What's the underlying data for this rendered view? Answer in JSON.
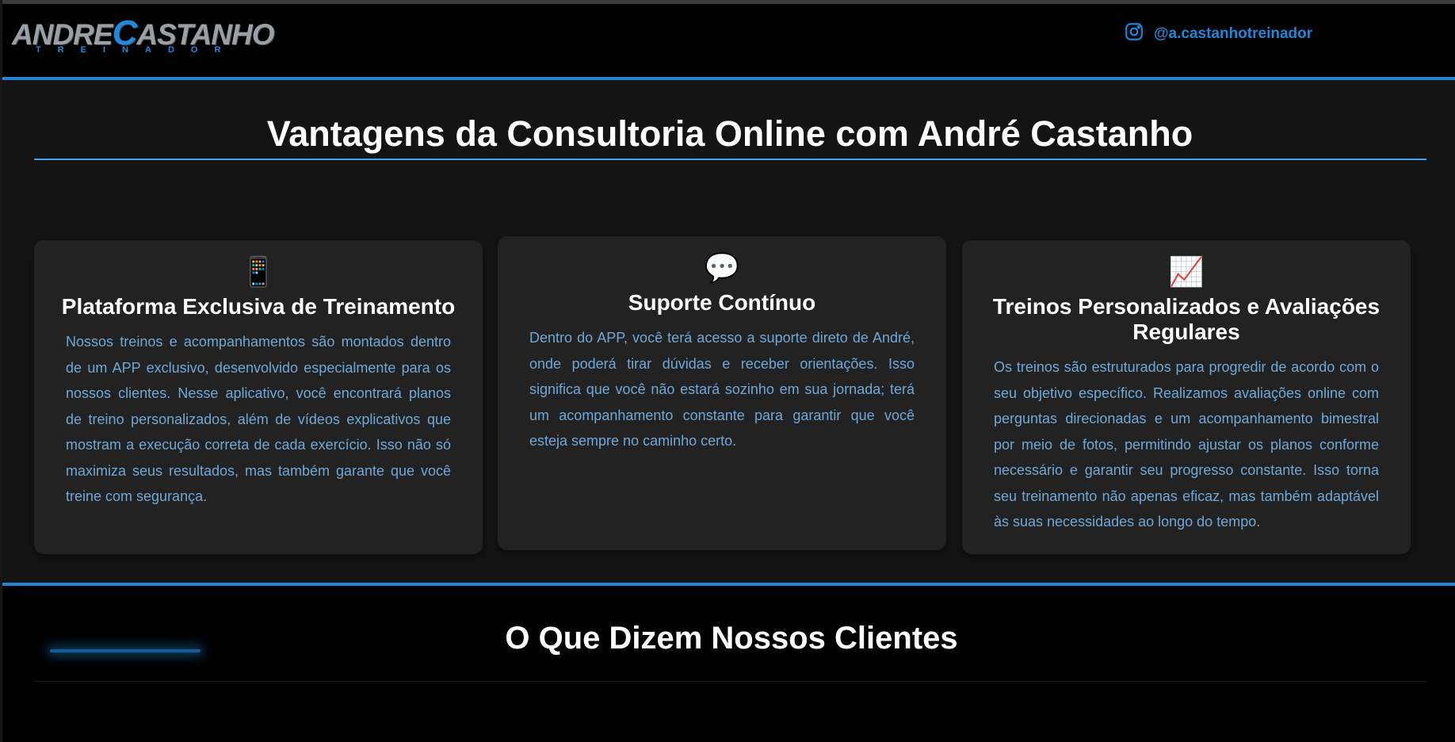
{
  "header": {
    "logo_main_1": "ANDRE",
    "logo_main_accent": "C",
    "logo_main_2": "ASTANHO",
    "logo_sub": "TREINADOR",
    "instagram_handle": "@a.castanhotreinador",
    "instagram_icon": "instagram-icon",
    "accent_color": "#1e88d8"
  },
  "advantages": {
    "title": "Vantagens da Consultoria Online com André Castanho",
    "cards": [
      {
        "icon": "📱",
        "icon_name": "mobile-phone-icon",
        "title": "Plataforma Exclusiva de Treinamento",
        "text": "Nossos treinos e acompanhamentos são montados dentro de um APP exclusivo, desenvolvido especialmente para os nossos clientes. Nesse aplicativo, você encontrará planos de treino personalizados, além de vídeos explicativos que mostram a execução correta de cada exercício. Isso não só maximiza seus resultados, mas também garante que você treine com segurança."
      },
      {
        "icon": "💬",
        "icon_name": "speech-bubble-icon",
        "title": "Suporte Contínuo",
        "text": "Dentro do APP, você terá acesso a suporte direto de André, onde poderá tirar dúvidas e receber orientações. Isso significa que você não estará sozinho em sua jornada; terá um acompanhamento constante para garantir que você esteja sempre no caminho certo."
      },
      {
        "icon": "📈",
        "icon_name": "chart-increasing-icon",
        "title": "Treinos Personalizados e Avaliações Regulares",
        "text": "Os treinos são estruturados para progredir de acordo com o seu objetivo específico. Realizamos avaliações online com perguntas direcionadas e um acompanhamento bimestral por meio de fotos, permitindo ajustar os planos conforme necessário e garantir seu progresso constante. Isso torna seu treinamento não apenas eficaz, mas também adaptável às suas necessidades ao longo do tempo."
      }
    ]
  },
  "clients": {
    "title": "O Que Dizem Nossos Clientes"
  }
}
